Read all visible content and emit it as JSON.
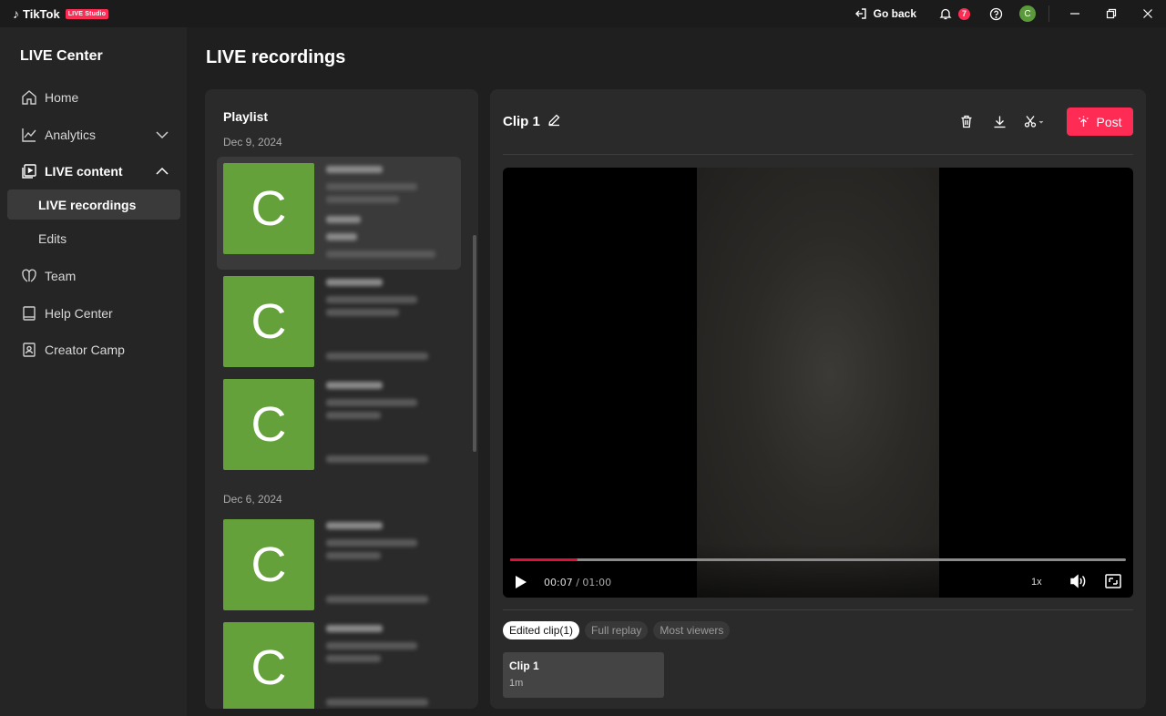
{
  "titlebar": {
    "brand": "TikTok",
    "studio_badge": "LIVE Studio",
    "go_back": "Go back",
    "notif_count": "7",
    "avatar_letter": "C"
  },
  "sidebar": {
    "title": "LIVE Center",
    "items": [
      {
        "label": "Home",
        "icon": "home-icon"
      },
      {
        "label": "Analytics",
        "icon": "analytics-icon"
      },
      {
        "label": "LIVE content",
        "icon": "live-content-icon"
      },
      {
        "label": "LIVE recordings",
        "icon": ""
      },
      {
        "label": "Edits",
        "icon": ""
      },
      {
        "label": "Team",
        "icon": "team-icon"
      },
      {
        "label": "Help Center",
        "icon": "book-icon"
      },
      {
        "label": "Creator Camp",
        "icon": "creator-camp-icon"
      }
    ],
    "active": "LIVE recordings"
  },
  "page": {
    "title": "LIVE recordings"
  },
  "playlist": {
    "title": "Playlist",
    "groups": [
      {
        "date": "Dec 9, 2024",
        "items": [
          {
            "thumb": "C",
            "selected": true
          },
          {
            "thumb": "C"
          },
          {
            "thumb": "C"
          }
        ]
      },
      {
        "date": "Dec 6, 2024",
        "items": [
          {
            "thumb": "C"
          },
          {
            "thumb": "C"
          }
        ]
      }
    ]
  },
  "clip": {
    "title": "Clip 1",
    "post_label": "Post",
    "current_time": "00:07",
    "total_time": "01:00",
    "progress_fraction": 0.11,
    "speed": "1x"
  },
  "tabs": [
    {
      "label": "Edited clip(1)",
      "active": true
    },
    {
      "label": "Full replay",
      "active": false
    },
    {
      "label": "Most viewers",
      "active": false
    }
  ],
  "clip_list": [
    {
      "name": "Clip 1",
      "duration": "1m"
    }
  ],
  "colors": {
    "accent": "#fe2c55",
    "thumb_green": "#64a13a",
    "progress_red": "#e0103a"
  }
}
